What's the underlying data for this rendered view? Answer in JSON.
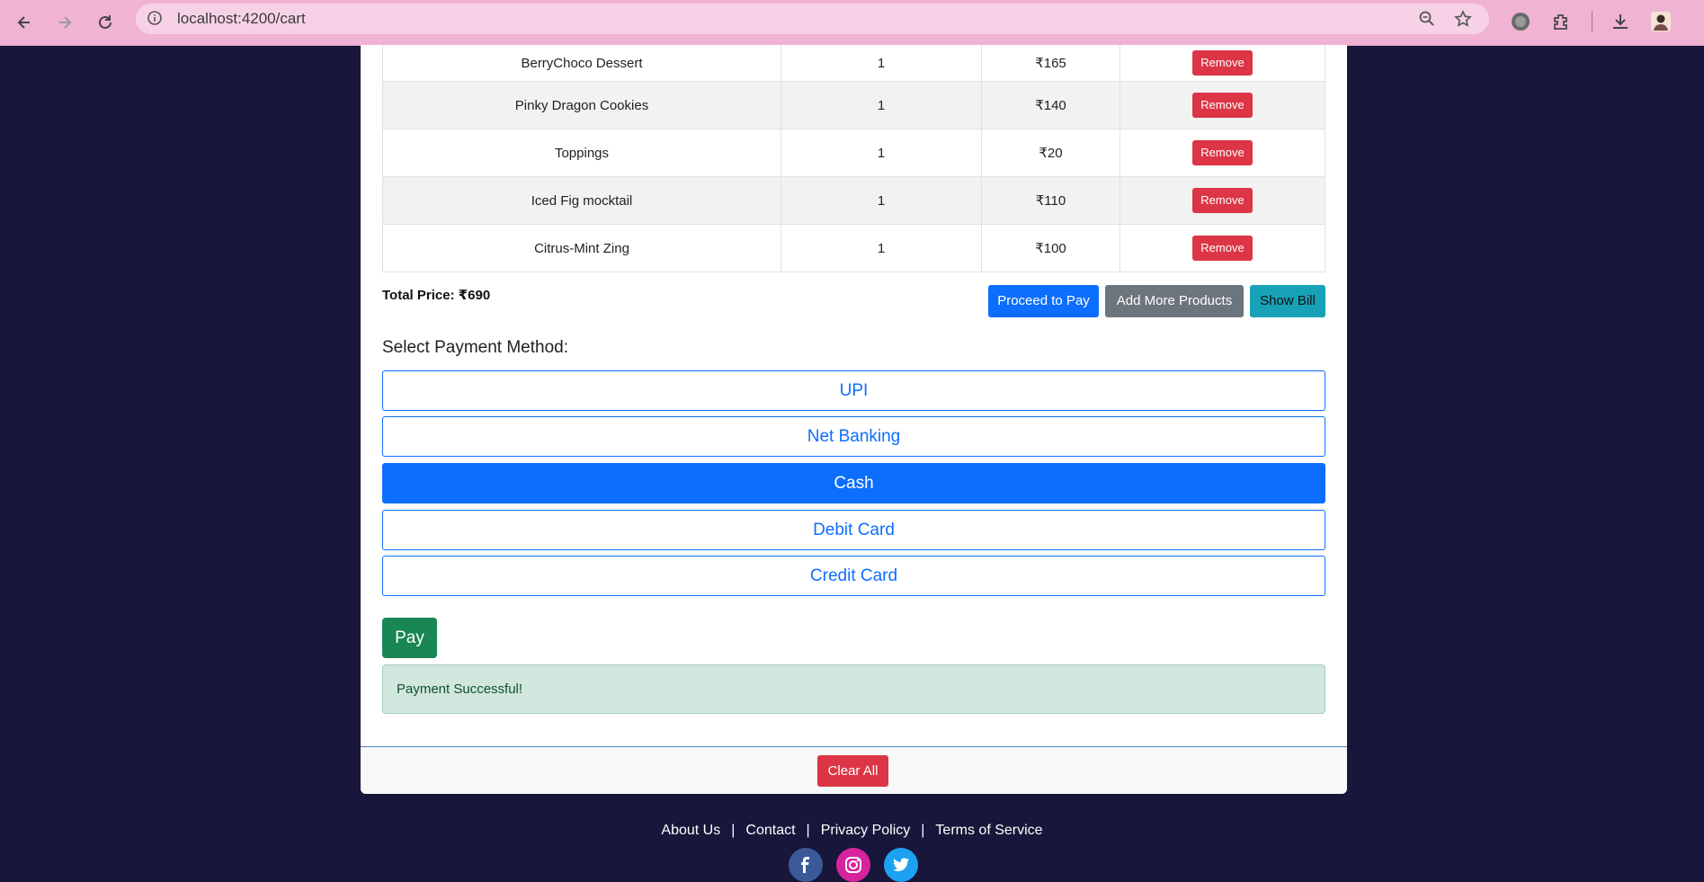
{
  "browser": {
    "url": "localhost:4200/cart"
  },
  "cart": {
    "items": [
      {
        "name": "BerryChoco Dessert",
        "qty": "1",
        "price": "₹165",
        "action": "Remove"
      },
      {
        "name": "Pinky Dragon Cookies",
        "qty": "1",
        "price": "₹140",
        "action": "Remove"
      },
      {
        "name": "Toppings",
        "qty": "1",
        "price": "₹20",
        "action": "Remove"
      },
      {
        "name": "Iced Fig mocktail",
        "qty": "1",
        "price": "₹110",
        "action": "Remove"
      },
      {
        "name": "Citrus-Mint Zing",
        "qty": "1",
        "price": "₹100",
        "action": "Remove"
      }
    ],
    "total": "Total Price: ₹690",
    "buttons": {
      "proceed": "Proceed to Pay",
      "add_more": "Add More Products",
      "show_bill": "Show Bill"
    }
  },
  "payment": {
    "title": "Select Payment Method:",
    "options": [
      "UPI",
      "Net Banking",
      "Cash",
      "Debit Card",
      "Credit Card"
    ],
    "selected": "Cash",
    "pay_label": "Pay",
    "status": "Payment Successful!"
  },
  "card_footer": {
    "clear_all": "Clear All"
  },
  "footer": {
    "links": [
      "About Us",
      "Contact",
      "Privacy Policy",
      "Terms of Service"
    ],
    "separator": "|"
  },
  "colors": {
    "page_bg": "#18163a",
    "primary": "#0d6efd",
    "danger": "#dc3545",
    "success": "#198754",
    "secondary": "#6c757d",
    "info": "#17a2b8",
    "browser_bar": "#f0b3d3"
  }
}
